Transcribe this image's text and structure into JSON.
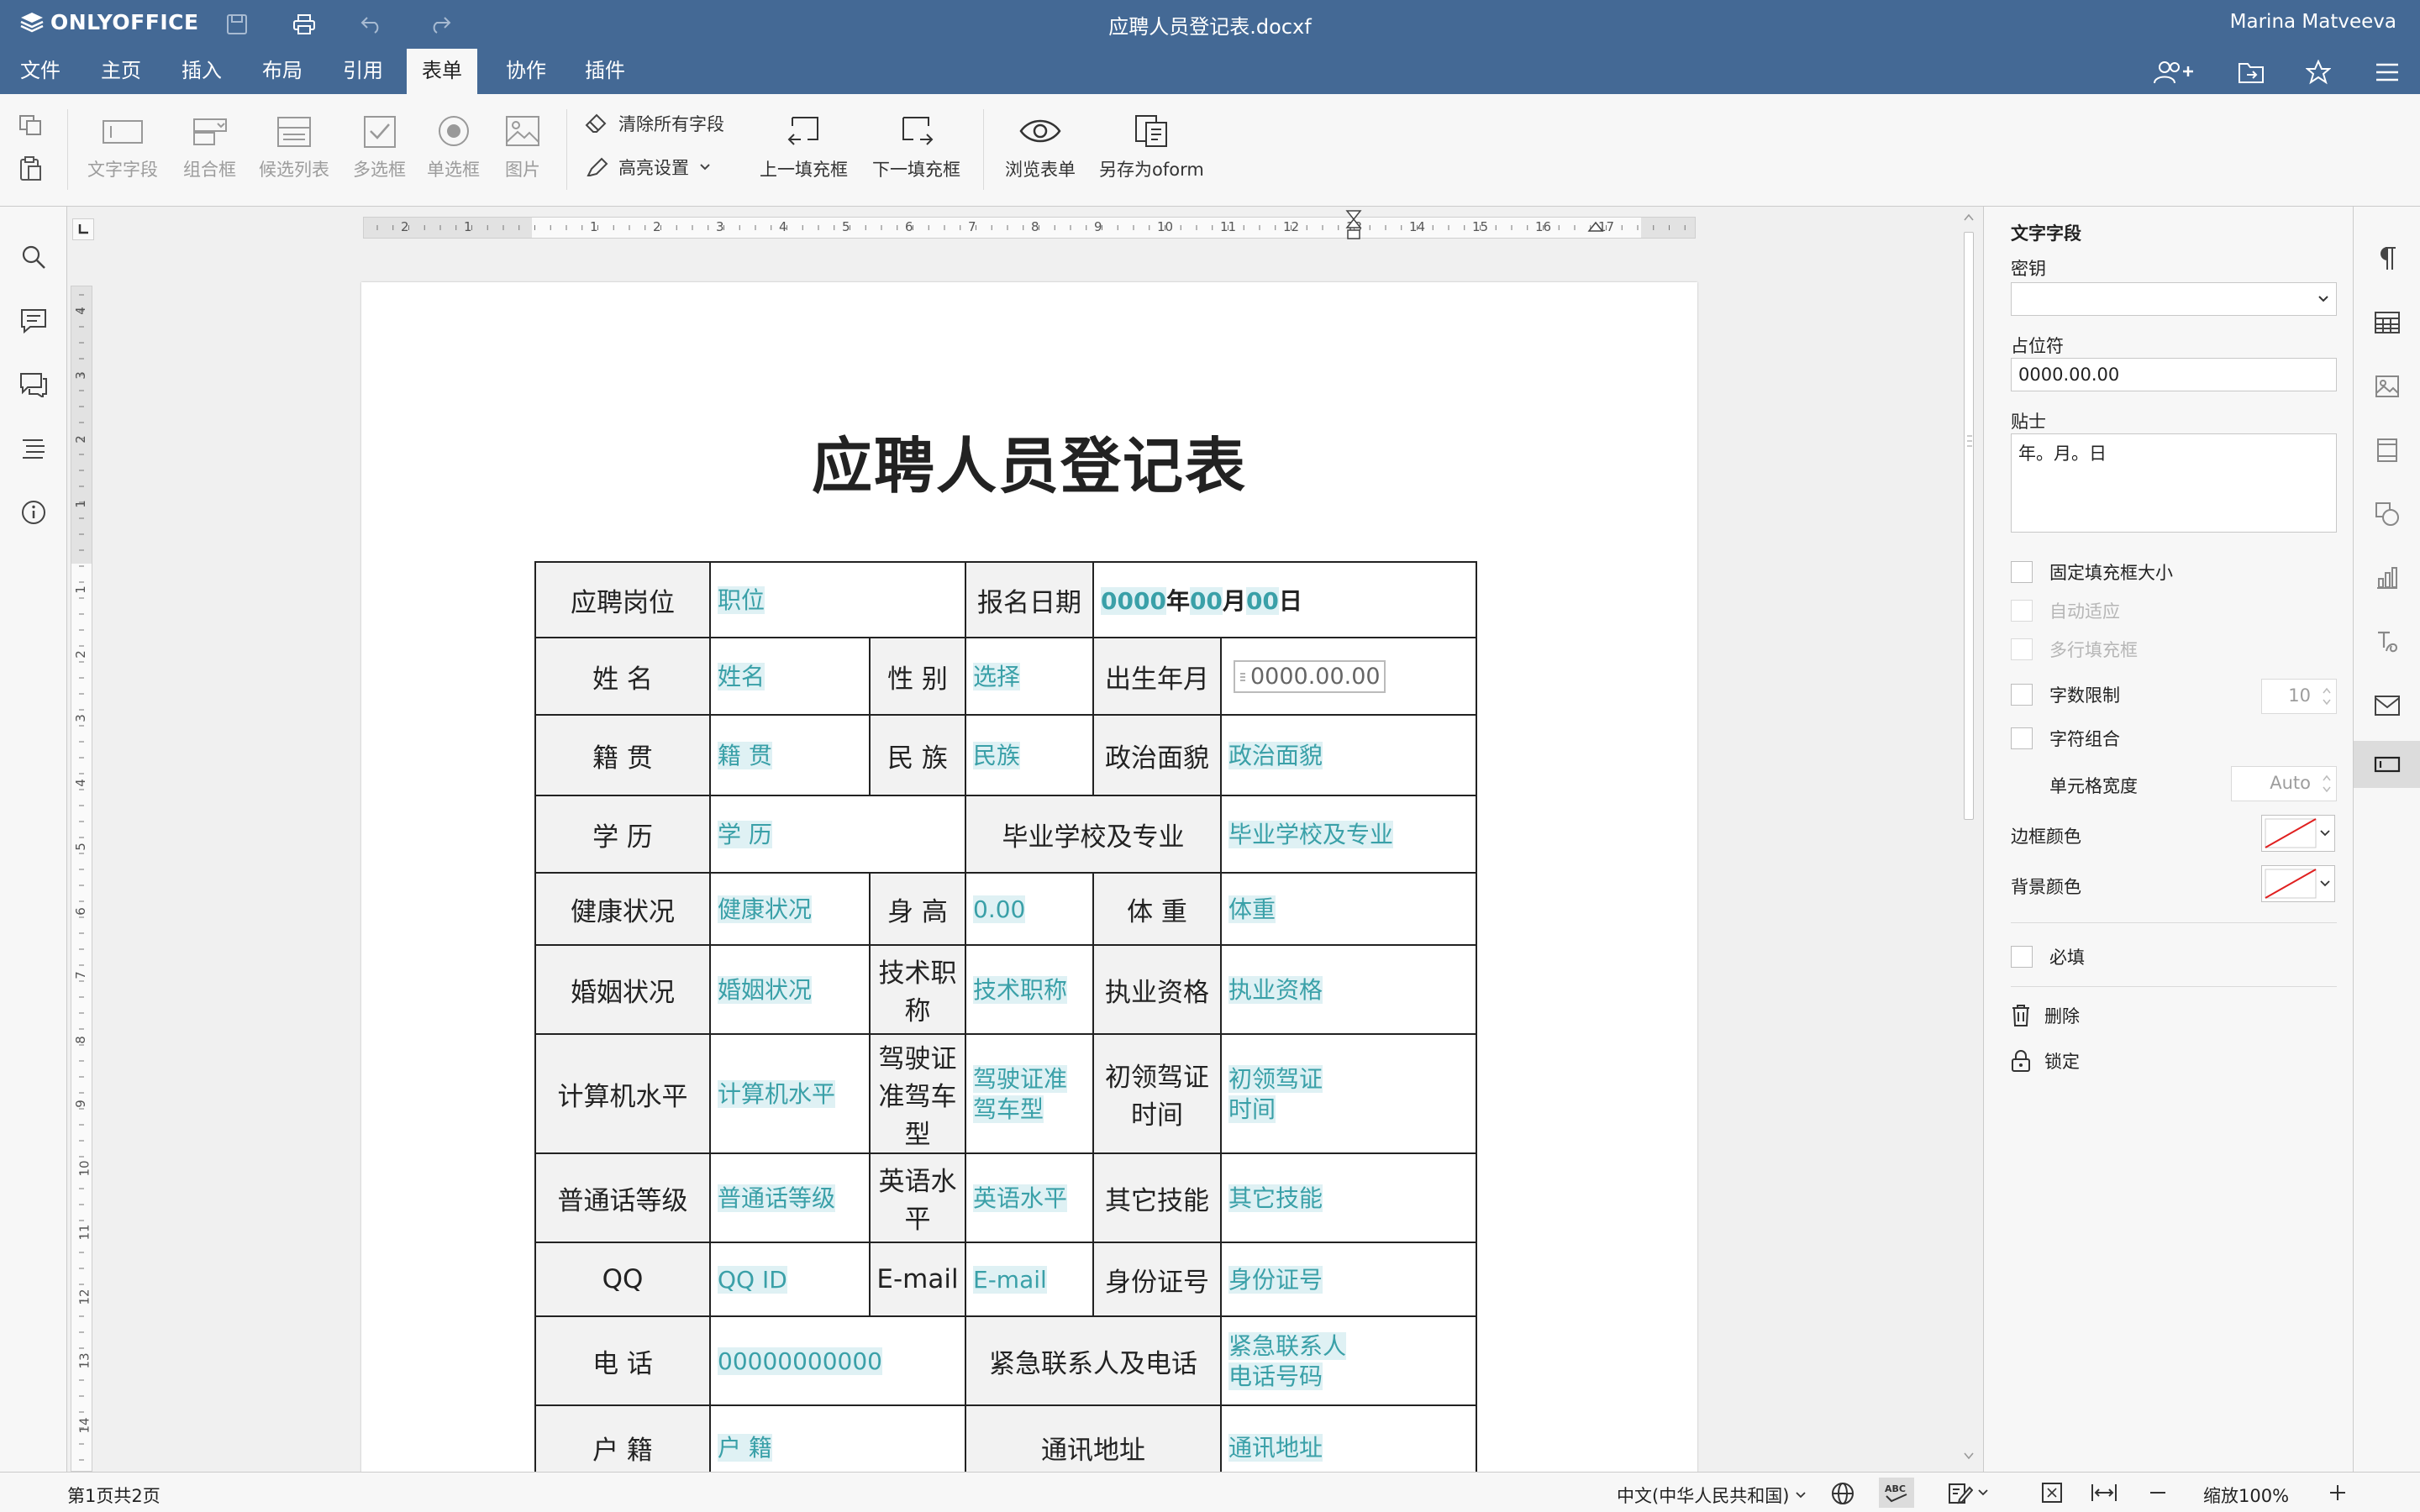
{
  "app": {
    "logo_text": "ONLYOFFICE",
    "doc_title": "应聘人员登记表.docxf",
    "user_name": "Marina Matveeva"
  },
  "menu": {
    "tabs": [
      "文件",
      "主页",
      "插入",
      "布局",
      "引用",
      "表单",
      "协作",
      "插件"
    ],
    "active_tab": "表单"
  },
  "toolbar": {
    "text_field": "文字字段",
    "combo_box": "组合框",
    "dropdown": "候选列表",
    "checkbox": "多选框",
    "radio": "单选框",
    "image": "图片",
    "clear_fields": "清除所有字段",
    "highlight": "高亮设置",
    "prev_field": "上一填充框",
    "next_field": "下一填充框",
    "view_form": "浏览表单",
    "save_oform": "另存为oform"
  },
  "ruler": {
    "h_labels": [
      "2",
      "1",
      "1",
      "2",
      "3",
      "4",
      "5",
      "6",
      "7",
      "8",
      "9",
      "10",
      "11",
      "12",
      "13",
      "14",
      "15",
      "16",
      "17"
    ],
    "v_labels": [
      "4",
      "3",
      "2",
      "1",
      "1",
      "2",
      "3",
      "4",
      "5",
      "6",
      "7",
      "8",
      "9",
      "10",
      "11",
      "12",
      "13",
      "14"
    ]
  },
  "document": {
    "heading": "应聘人员登记表",
    "rows": {
      "r1": {
        "l1": "应聘岗位",
        "v1": "职位",
        "l2": "报名日期",
        "d1": "0000",
        "d2": "年",
        "d3": "00",
        "d4": "月",
        "d5": "00",
        "d6": "日"
      },
      "r2": {
        "l1": "姓 名",
        "v1": "姓名",
        "l2": "性 别",
        "v2": "选择",
        "l3": "出生年月",
        "v3": "0000.00.00"
      },
      "r3": {
        "l1": "籍 贯",
        "v1": "籍 贯",
        "l2": "民 族",
        "v2": "民族",
        "l3": "政治面貌",
        "v3": "政治面貌"
      },
      "r4": {
        "l1": "学 历",
        "v1": "学 历",
        "l2": "毕业学校及专业",
        "v2": "毕业学校及专业"
      },
      "r5": {
        "l1": "健康状况",
        "v1": "健康状况",
        "l2": "身 高",
        "v2": "0.00",
        "l3": "体 重",
        "v3": "体重"
      },
      "r6": {
        "l1": "婚姻状况",
        "v1": "婚姻状况",
        "l2a": "技术职",
        "l2b": "称",
        "v2": "技术职称",
        "l3": "执业资格",
        "v3": "执业资格"
      },
      "r7": {
        "l1": "计算机水平",
        "v1": "计算机水平",
        "l2a": "驾驶证",
        "l2b": "准驾车",
        "l2c": "型",
        "v2a": "驾驶证准",
        "v2b": "驾车型",
        "l3a": "初领驾证",
        "l3b": "时间",
        "v3a": "初领驾证",
        "v3b": "时间"
      },
      "r8": {
        "l1": "普通话等级",
        "v1": "普通话等级",
        "l2a": "英语水",
        "l2b": "平",
        "v2": "英语水平",
        "l3": "其它技能",
        "v3": "其它技能"
      },
      "r9": {
        "l1": "QQ",
        "v1": "QQ ID",
        "l2": "E-mail",
        "v2": "E-mail",
        "l3": "身份证号",
        "v3": "身份证号"
      },
      "r10": {
        "l1": "电 话",
        "v1": "00000000000",
        "l2": "紧急联系人及电话",
        "v2a": "紧急联系人",
        "v2b": "电话号码"
      },
      "r11": {
        "l1": "户 籍",
        "v1": "户 籍",
        "l2": "通讯地址",
        "v2": "通讯地址"
      }
    }
  },
  "settings": {
    "title": "文字字段",
    "key_label": "密钥",
    "key_value": "",
    "placeholder_label": "占位符",
    "placeholder_value": "0000.00.00",
    "tip_label": "贴士",
    "tip_value": "年。月。日",
    "fixed_size": "固定填充框大小",
    "autofit": "自动适应",
    "multiline": "多行填充框",
    "char_limit": "字数限制",
    "char_limit_value": "10",
    "comb": "字符组合",
    "cell_width": "单元格宽度",
    "cell_width_value": "Auto",
    "border_color": "边框颜色",
    "bg_color": "背景颜色",
    "required": "必填",
    "delete": "删除",
    "lock": "锁定"
  },
  "status": {
    "page_info": "第1页共2页",
    "language": "中文(中华人民共和国)",
    "zoom": "缩放100%"
  },
  "colors": {
    "header_bg": "#446995",
    "field_fill": "#dff1f4",
    "field_text": "#3aa0a8"
  }
}
